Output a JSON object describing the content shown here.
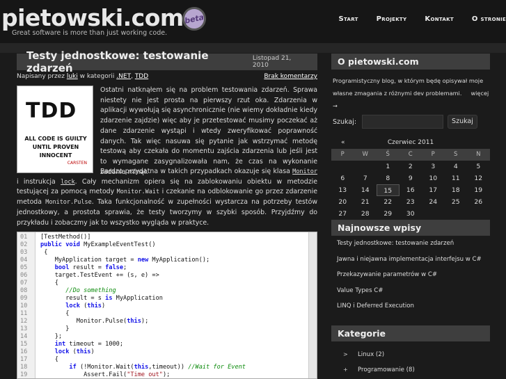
{
  "header": {
    "logo": "pietowski.com",
    "badge": "beta",
    "tagline": "Great software is more than just working code.",
    "nav": [
      "Start",
      "Projekty",
      "Kontakt",
      "O stronie"
    ]
  },
  "post": {
    "title": "Testy jednostkowe: testowanie zdarzeń",
    "date": "Listopad 21, 2010",
    "meta_prefix": "Napisany przez",
    "author": "luki",
    "meta_mid": "w kategorii",
    "cat1": ".NET",
    "cat2": "TDD",
    "comments": "Brak komentarzy",
    "image": {
      "big": "TDD",
      "line1": "ALL CODE IS GUILTY",
      "line2": "UNTIL PROVEN INNOCENT",
      "sig": "CARSTEN"
    },
    "p1": "Ostatni natknąłem się na problem testowania zdarzeń. Sprawa niestety nie jest prosta na pierwszy rzut oka. Zdarzenia w aplikacji wywołują się asynchronicznie (nie wiemy dokładnie kiedy zdarzenie zajdzie) więc aby je przetestować musimy poczekać aż dane zdarzenie wystąpi i wtedy zweryfikować poprawność danych. Tak więc nasuwa się pytanie jak wstrzymać metodę testową aby czekała do momentu zajścia zdarzenia lub jeśli jest to wymagane zasygnalizowała nam, że czas na wykonanie zadania minął.",
    "p2a": "Bardzo przydatna w takich przypadkach okazuje się klasa",
    "p2_monitor": "Monitor",
    "p2b": "i instrukcja",
    "p2_lock": "lock",
    "p2c": ". Cały mechanizm opiera się na zablokowaniu obiektu w metodzie testującej za pomocą metody",
    "p2_wait": "Monitor.Wait",
    "p2d": "i czekanie na odblokowanie go przez zdarzenie metoda",
    "p2_pulse": "Monitor.Pulse",
    "p2e": ". Taka funkcjonalność w zupełności wystarcza na potrzeby testów jednostkowy, a prostota sprawia, że testy tworzymy w szybki sposób. Przyjdźmy do przykładu i zobaczmy jak to wszystko wygląda w praktyce."
  },
  "code_numbers": [
    "01",
    "02",
    "03",
    "04",
    "05",
    "06",
    "07",
    "08",
    "09",
    "10",
    "11",
    "12",
    "13",
    "14",
    "15",
    "16",
    "17",
    "18",
    "19",
    "20"
  ],
  "code": {
    "l1": "[TestMethod()]",
    "l2_kw": "public void",
    "l2": " MyExampleEventTest()",
    "l3": "{",
    "l4a": "MyApplication target = ",
    "l4_kw": "new",
    "l4b": " MyApplication();",
    "l5_kw": "bool",
    "l5a": " result = ",
    "l5_kw2": "false",
    "l5b": ";",
    "l6": "target.TestEvent += (s, e) =>",
    "l7": "{",
    "l8": "//Do something",
    "l9a": "result = s ",
    "l9_kw": "is",
    "l9b": " MyApplication",
    "l10_kw": "lock",
    "l10a": " (",
    "l10_kw2": "this",
    "l10b": ")",
    "l11": "{",
    "l12a": "Monitor.Pulse(",
    "l12_kw": "this",
    "l12b": ");",
    "l13": "}",
    "l14": "};",
    "l15_kw": "int",
    "l15": " timeout = 1000;",
    "l16_kw": "lock",
    "l16a": " (",
    "l16_kw2": "this",
    "l16b": ")",
    "l17": "{",
    "l18_kw": "if",
    "l18a": " (!Monitor.Wait(",
    "l18_kw2": "this",
    "l18b": ",timeout)) ",
    "l18_cm": "//Wait for Event",
    "l19a": "Assert.Fail(",
    "l19_st": "\"Time out\"",
    "l19b": ");"
  },
  "sidebar": {
    "about_title": "O pietowski.com",
    "about_text": "Programistyczny blog, w którym będę opisywał moje własne zmagania z różnymi dev problemami.",
    "about_more": "więcej →",
    "search_label": "Szukaj:",
    "search_value": "",
    "search_button": "Szukaj",
    "calendar": {
      "prev": "«",
      "month": "Czerwiec 2011",
      "days": [
        "P",
        "W",
        "Ś",
        "C",
        "P",
        "S",
        "N"
      ],
      "weeks": [
        [
          "",
          "",
          "1",
          "2",
          "3",
          "4",
          "5"
        ],
        [
          "6",
          "7",
          "8",
          "9",
          "10",
          "11",
          "12"
        ],
        [
          "13",
          "14",
          "15",
          "16",
          "17",
          "18",
          "19"
        ],
        [
          "20",
          "21",
          "22",
          "23",
          "24",
          "25",
          "26"
        ],
        [
          "27",
          "28",
          "29",
          "30",
          "",
          "",
          ""
        ]
      ],
      "today": "15"
    },
    "recent_title": "Najnowsze wpisy",
    "recent": [
      "Testy jednostkowe: testowanie zdarzeń",
      "Jawna i niejawna implementacja interfejsu w C#",
      "Przekazywanie parametrów w C#",
      "Value Types C#",
      "LINQ i Deferred Execution"
    ],
    "categories_title": "Kategorie",
    "categories": [
      {
        "arrow": ">",
        "label": "Linux (2)"
      },
      {
        "arrow": "+",
        "label": "Programowanie (8)"
      }
    ]
  }
}
